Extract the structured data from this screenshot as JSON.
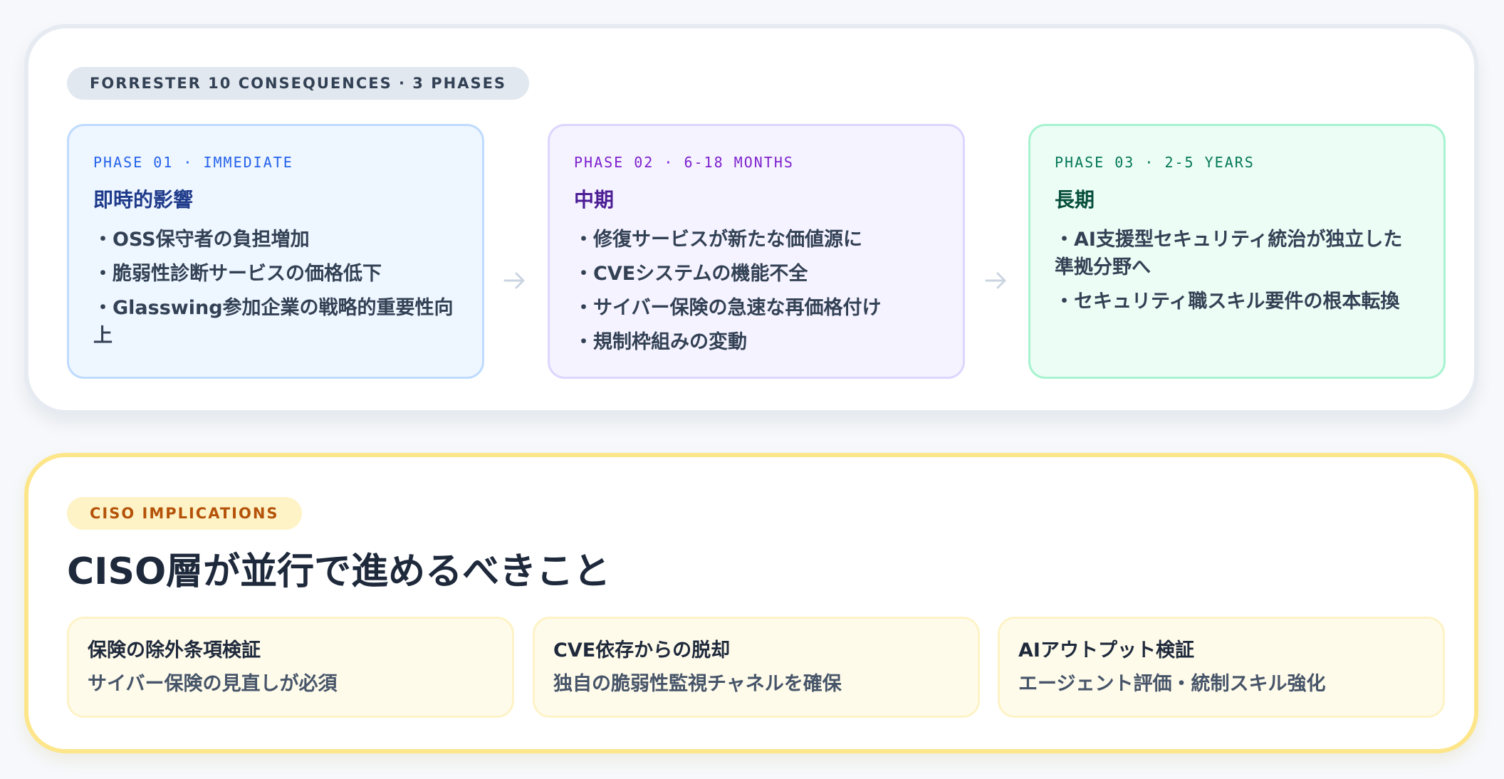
{
  "top": {
    "pill": "FORRESTER 10 CONSEQUENCES · 3 PHASES",
    "phases": [
      {
        "label": "PHASE 01 · IMMEDIATE",
        "title": "即時的影響",
        "items": [
          "・OSS保守者の負担増加",
          "・脆弱性診断サービスの価格低下",
          "・Glasswing参加企業の戦略的重要性向上"
        ]
      },
      {
        "label": "PHASE 02 · 6-18 MONTHS",
        "title": "中期",
        "items": [
          "・修復サービスが新たな価値源に",
          "・CVEシステムの機能不全",
          "・サイバー保険の急速な再価格付け",
          "・規制枠組みの変動"
        ]
      },
      {
        "label": "PHASE 03 · 2-5 YEARS",
        "title": "長期",
        "items": [
          "・AI支援型セキュリティ統治が独立した準拠分野へ",
          "・セキュリティ職スキル要件の根本転換"
        ]
      }
    ]
  },
  "bottom": {
    "pill": "CISO IMPLICATIONS",
    "title": "CISO層が並行で進めるべきこと",
    "boxes": [
      {
        "title": "保険の除外条項検証",
        "text": "サイバー保険の見直しが必須"
      },
      {
        "title": "CVE依存からの脱却",
        "text": "独自の脆弱性監視チャネルを確保"
      },
      {
        "title": "AIアウトプット検証",
        "text": "エージェント評価・統制スキル強化"
      }
    ]
  }
}
